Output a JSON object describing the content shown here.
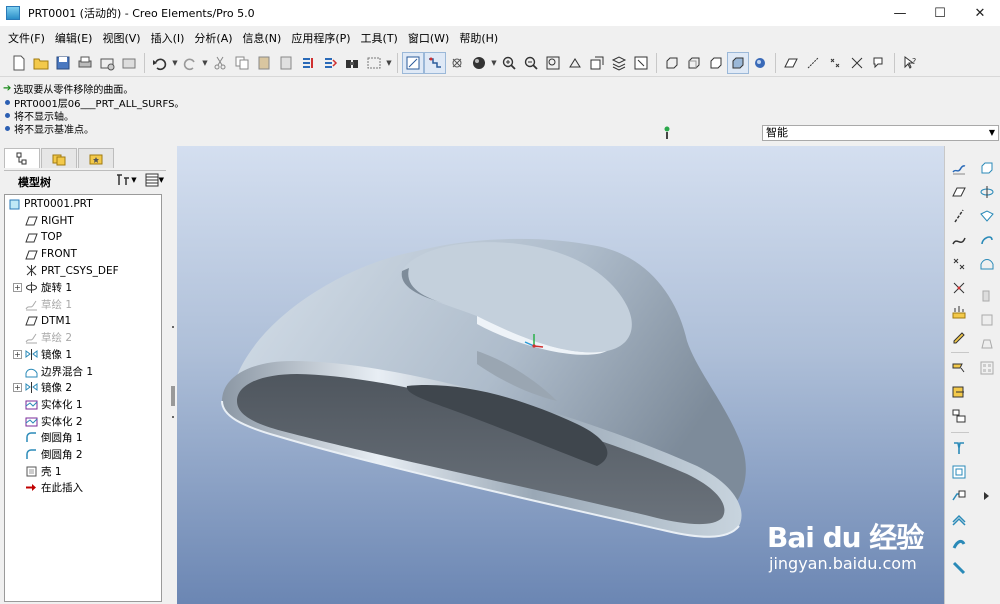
{
  "window": {
    "title": "PRT0001 (活动的) - Creo Elements/Pro 5.0",
    "min_glyph": "—",
    "max_glyph": "☐",
    "close_glyph": "✕"
  },
  "menu": {
    "items": [
      {
        "label": "文件(F)"
      },
      {
        "label": "编辑(E)"
      },
      {
        "label": "视图(V)"
      },
      {
        "label": "插入(I)"
      },
      {
        "label": "分析(A)"
      },
      {
        "label": "信息(N)"
      },
      {
        "label": "应用程序(P)"
      },
      {
        "label": "工具(T)"
      },
      {
        "label": "窗口(W)"
      },
      {
        "label": "帮助(H)"
      }
    ]
  },
  "messages": [
    {
      "text": "选取要从零件移除的曲面。",
      "kind": "prompt"
    },
    {
      "text": "PRT0001层06___PRT_ALL_SURFS。",
      "kind": "info"
    },
    {
      "text": "将不显示轴。",
      "kind": "info"
    },
    {
      "text": "将不显示基准点。",
      "kind": "info"
    }
  ],
  "filter": {
    "value": "智能"
  },
  "model_tree": {
    "title": "模型树",
    "items": [
      {
        "label": "PRT0001.PRT",
        "icon": "part-icon",
        "expander": "",
        "dim": false
      },
      {
        "label": "RIGHT",
        "icon": "datum-plane-icon",
        "expander": "",
        "dim": false
      },
      {
        "label": "TOP",
        "icon": "datum-plane-icon",
        "expander": "",
        "dim": false
      },
      {
        "label": "FRONT",
        "icon": "datum-plane-icon",
        "expander": "",
        "dim": false
      },
      {
        "label": "PRT_CSYS_DEF",
        "icon": "csys-icon",
        "expander": "",
        "dim": false
      },
      {
        "label": "旋转 1",
        "icon": "revolve-icon",
        "expander": "+",
        "dim": false
      },
      {
        "label": "草绘 1",
        "icon": "sketch-icon",
        "expander": "",
        "dim": true
      },
      {
        "label": "DTM1",
        "icon": "datum-plane-icon",
        "expander": "",
        "dim": false
      },
      {
        "label": "草绘 2",
        "icon": "sketch-icon",
        "expander": "",
        "dim": true
      },
      {
        "label": "镜像 1",
        "icon": "mirror-icon",
        "expander": "+",
        "dim": false
      },
      {
        "label": "边界混合 1",
        "icon": "boundary-blend-icon",
        "expander": "",
        "dim": false
      },
      {
        "label": "镜像 2",
        "icon": "mirror-icon",
        "expander": "+",
        "dim": false
      },
      {
        "label": "实体化 1",
        "icon": "solidify-icon",
        "expander": "",
        "dim": false
      },
      {
        "label": "实体化 2",
        "icon": "solidify-icon",
        "expander": "",
        "dim": false
      },
      {
        "label": "倒圆角 1",
        "icon": "round-icon",
        "expander": "",
        "dim": false
      },
      {
        "label": "倒圆角 2",
        "icon": "round-icon",
        "expander": "",
        "dim": false
      },
      {
        "label": "壳 1",
        "icon": "shell-icon",
        "expander": "",
        "dim": false
      },
      {
        "label": "在此插入",
        "icon": "insert-here-arrow-icon",
        "expander": "",
        "dim": false
      }
    ]
  },
  "watermark": {
    "logo": "Bai du 经验",
    "url": "jingyan.baidu.com"
  },
  "colors": {
    "accent": "#2b5fb3",
    "viewport_top": "#d4dff0",
    "viewport_bottom": "#6b86b3",
    "model_surface": "#b8c8d8",
    "model_shadow": "#5d6670",
    "insert_arrow": "#c00000"
  }
}
